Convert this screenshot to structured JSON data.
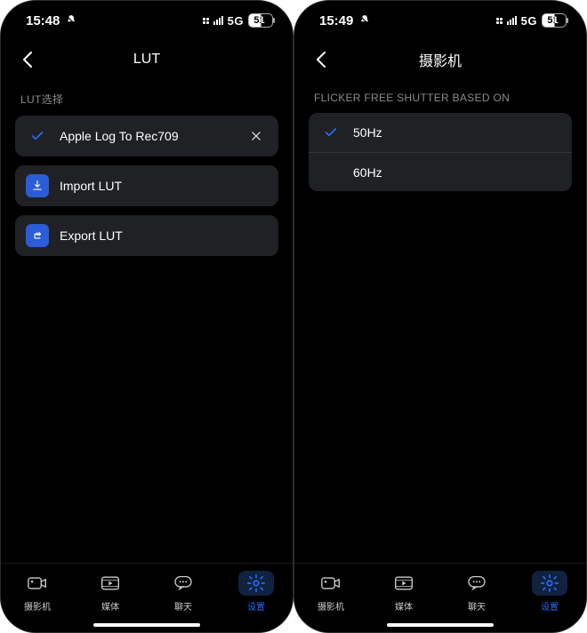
{
  "left": {
    "status": {
      "time": "15:48",
      "network": "5G",
      "battery": "51"
    },
    "title": "LUT",
    "section_label": "LUT选择",
    "selected_lut": "Apple Log To Rec709",
    "import_label": "Import LUT",
    "export_label": "Export LUT",
    "tabs": [
      "摄影机",
      "媒体",
      "聊天",
      "设置"
    ],
    "active_tab": 3
  },
  "right": {
    "status": {
      "time": "15:49",
      "network": "5G",
      "battery": "51"
    },
    "title": "摄影机",
    "section_label": "FLICKER FREE SHUTTER BASED ON",
    "options": [
      {
        "label": "50Hz",
        "selected": true
      },
      {
        "label": "60Hz",
        "selected": false
      }
    ],
    "tabs": [
      "摄影机",
      "媒体",
      "聊天",
      "设置"
    ],
    "active_tab": 3
  }
}
